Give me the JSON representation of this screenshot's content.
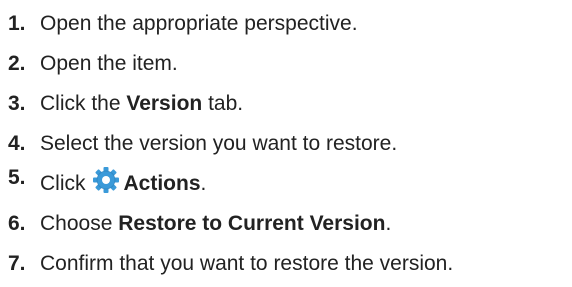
{
  "steps": [
    {
      "number": "1.",
      "parts": [
        "Open the appropriate perspective."
      ]
    },
    {
      "number": "2.",
      "parts": [
        "Open the item."
      ]
    },
    {
      "number": "3.",
      "parts": [
        "Click the ",
        "Version",
        " tab."
      ]
    },
    {
      "number": "4.",
      "parts": [
        "Select the version you want to restore."
      ]
    },
    {
      "number": "5.",
      "parts": [
        "Click",
        "Actions",
        "."
      ],
      "icon": "gear-icon"
    },
    {
      "number": "6.",
      "parts": [
        "Choose ",
        "Restore to Current Version",
        "."
      ]
    },
    {
      "number": "7.",
      "parts": [
        "Confirm that you want to restore the version."
      ]
    }
  ],
  "colors": {
    "text": "#222222",
    "icon": "#3a9ad9"
  }
}
